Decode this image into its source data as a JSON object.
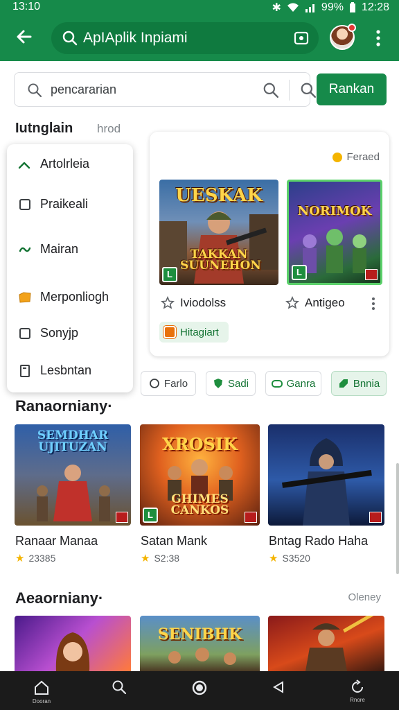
{
  "status": {
    "time_left": "13:10",
    "time_right": "12:28",
    "battery": "99%"
  },
  "appbar": {
    "search_text": "ApIAplik Inpiami"
  },
  "search": {
    "placeholder": "pencararian",
    "rank_button": "Rankan"
  },
  "filter": {
    "title": "Iutnglain",
    "hint": "hrod",
    "menu_items": [
      "Artolrleia",
      "Praikeali",
      "Mairan",
      "Merponliogh",
      "Sonyjp",
      "Lesbntan"
    ]
  },
  "featured": {
    "tag": "Feraed",
    "games": [
      {
        "art_title": "UESKAK",
        "art_subtitle": "TAKKAN SUUNEHON",
        "label": "Iviodolss"
      },
      {
        "art_title": "NORIMOK",
        "label": "Antigeo"
      }
    ],
    "chip": "Hitagiart"
  },
  "chips": [
    "Farlo",
    "Sadi",
    "Ganra",
    "Bnnia"
  ],
  "sections": [
    {
      "title": "Ranaorniany·",
      "games": [
        {
          "art_title": "SEMDHAR UJITUZAN",
          "name": "Ranaar Manaa",
          "rating": "23385"
        },
        {
          "art_title": "XROSIK",
          "art_subtitle": "GHIMES CANKOS",
          "name": "Satan Mank",
          "rating": "S2:38"
        },
        {
          "art_title": "",
          "name": "Bntag Rado Haha",
          "rating": "S3520"
        }
      ]
    },
    {
      "title": "Aeaorniany·",
      "more": "Oleney",
      "games": [
        {
          "art_title": ""
        },
        {
          "art_title": "SENIBHK"
        },
        {
          "art_title": ""
        }
      ]
    }
  ],
  "nav": {
    "home_label": "Dooran",
    "more_label": "Rnore"
  },
  "colors": {
    "brand_green": "#168a4a",
    "brand_green_dark": "#0f7a3f",
    "rating_star": "#f4b400"
  }
}
